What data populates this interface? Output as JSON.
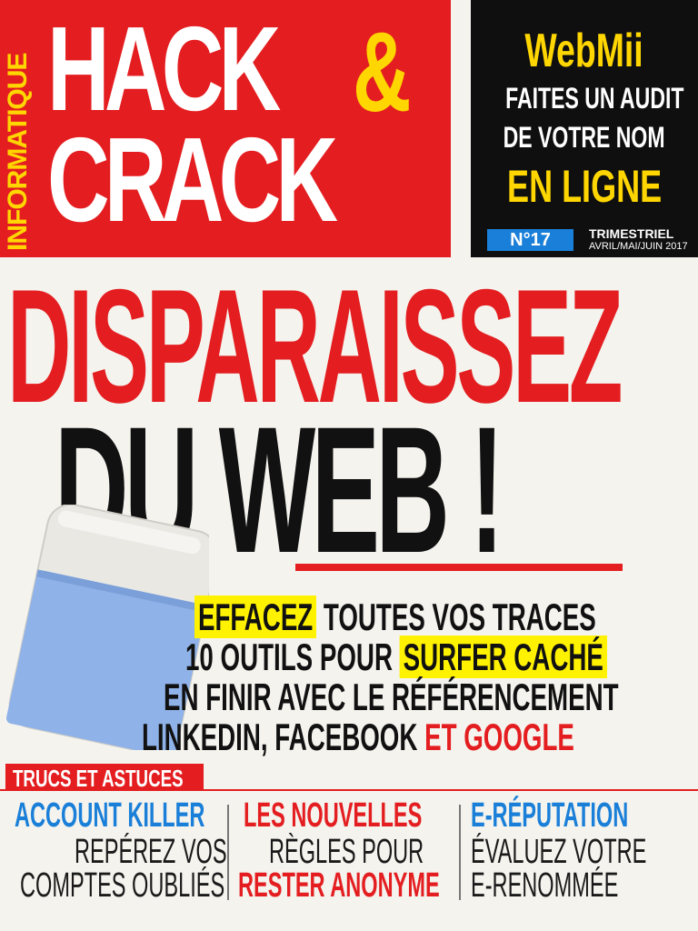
{
  "masthead": {
    "sidebar_text": "INFORMATIQUE",
    "title_line1": "HACK",
    "ampersand": "&",
    "title_line2": "CRACK"
  },
  "promo": {
    "title": "WebMii",
    "line1": "FAITES UN AUDIT",
    "line2": "DE VOTRE NOM",
    "line3": "EN LIGNE"
  },
  "issue": {
    "number": "N°17",
    "frequency": "TRIMESTRIEL",
    "date": "AVRIL/MAI/JUIN 2017"
  },
  "headline": {
    "line1": "DISPARAISSEZ",
    "line2": "DU WEB !"
  },
  "bullets": {
    "b1_highlight": "EFFACEZ",
    "b1_rest": " TOUTES VOS TRACES",
    "b2_start": "10 OUTILS POUR ",
    "b2_highlight": "SURFER CACHÉ",
    "b3": "EN FINIR AVEC LE RÉFÉRENCEMENT",
    "b4_start": "LINKEDIN, FACEBOOK ",
    "b4_red": "ET GOOGLE"
  },
  "footer": {
    "section_label": "TRUCS ET ASTUCES",
    "col1": {
      "title": "ACCOUNT KILLER",
      "line1": "REPÉREZ VOS",
      "line2": "COMPTES OUBLIÉS"
    },
    "col2": {
      "title": "LES NOUVELLES",
      "line1": "RÈGLES POUR",
      "line2": "RESTER ANONYME"
    },
    "col3": {
      "title": "E-RÉPUTATION",
      "line1": "ÉVALUEZ VOTRE",
      "line2": "E-RENOMMÉE"
    }
  },
  "colors": {
    "brand_red": "#e41e20",
    "brand_yellow": "#ffd600",
    "accent_blue": "#1a7fd8",
    "highlight_yellow": "#fff200"
  }
}
